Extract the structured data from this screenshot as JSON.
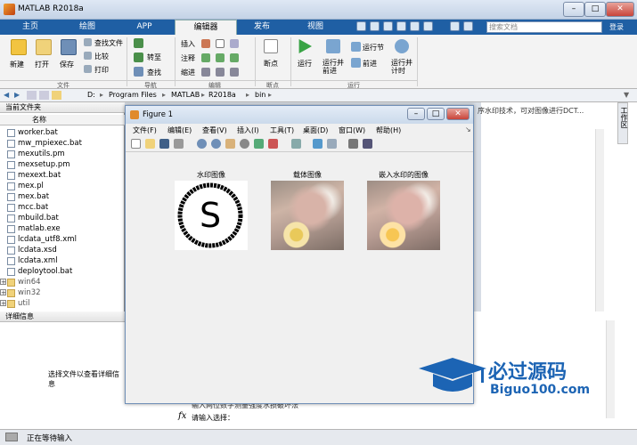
{
  "window": {
    "title": "MATLAB R2018a"
  },
  "tabs": [
    "主页",
    "绘图",
    "APP",
    "编辑器",
    "发布",
    "视图"
  ],
  "search_placeholder": "搜索文档",
  "login": "登录",
  "ribbon": {
    "new": "新建",
    "open": "打开",
    "save": "保存",
    "find_files": "查找文件",
    "compare": "比较",
    "print": "打印",
    "insert": "插入",
    "comment": "注释",
    "indent": "缩进",
    "goto": "转至",
    "find": "查找",
    "breakpoints": "断点",
    "run": "运行",
    "run_advance": "运行并\n前进",
    "run_section": "运行节",
    "advance": "前进",
    "run_time": "运行并\n计时",
    "groups": {
      "file": "文件",
      "navigate": "导航",
      "edit": "编辑",
      "breakpoints": "断点",
      "run": "运行"
    }
  },
  "address": {
    "path": [
      "D:",
      "Program Files",
      "MATLAB",
      "R2018a",
      "bin"
    ]
  },
  "current_folder": {
    "title": "当前文件夹",
    "col_name": "名称",
    "files": [
      "worker.bat",
      "mw_mpiexec.bat",
      "mexutils.pm",
      "mexsetup.pm",
      "mexext.bat",
      "mex.pl",
      "mex.bat",
      "mcc.bat",
      "mbuild.bat",
      "matlab.exe",
      "lcdata_utf8.xml",
      "lcdata.xsd",
      "lcdata.xml",
      "deploytool.bat"
    ],
    "folders": [
      "win64",
      "win32",
      "util"
    ]
  },
  "details": {
    "title": "详细信息",
    "message": "选择文件以查看详细信息"
  },
  "workspace": {
    "tab": "工作区"
  },
  "editor_snippet": "序水印技术，可对图像进行DCT...",
  "figure": {
    "title": "Figure 1",
    "menus": [
      "文件(F)",
      "编辑(E)",
      "查看(V)",
      "插入(I)",
      "工具(T)",
      "桌面(D)",
      "窗口(W)",
      "帮助(H)"
    ],
    "axes": [
      {
        "title": "水印图像",
        "kind": "watermark"
      },
      {
        "title": "载体图像",
        "kind": "photo"
      },
      {
        "title": "嵌入水印的图像",
        "kind": "photo"
      }
    ]
  },
  "command": {
    "line1": "输入两位数字测量强度水损破坏法",
    "prompt_symbol": "fx",
    "prompt": "请输入选择："
  },
  "status": {
    "text": "正在等待输入"
  },
  "watermark": {
    "brand": "必过源码",
    "url": "Biguo100.com"
  }
}
